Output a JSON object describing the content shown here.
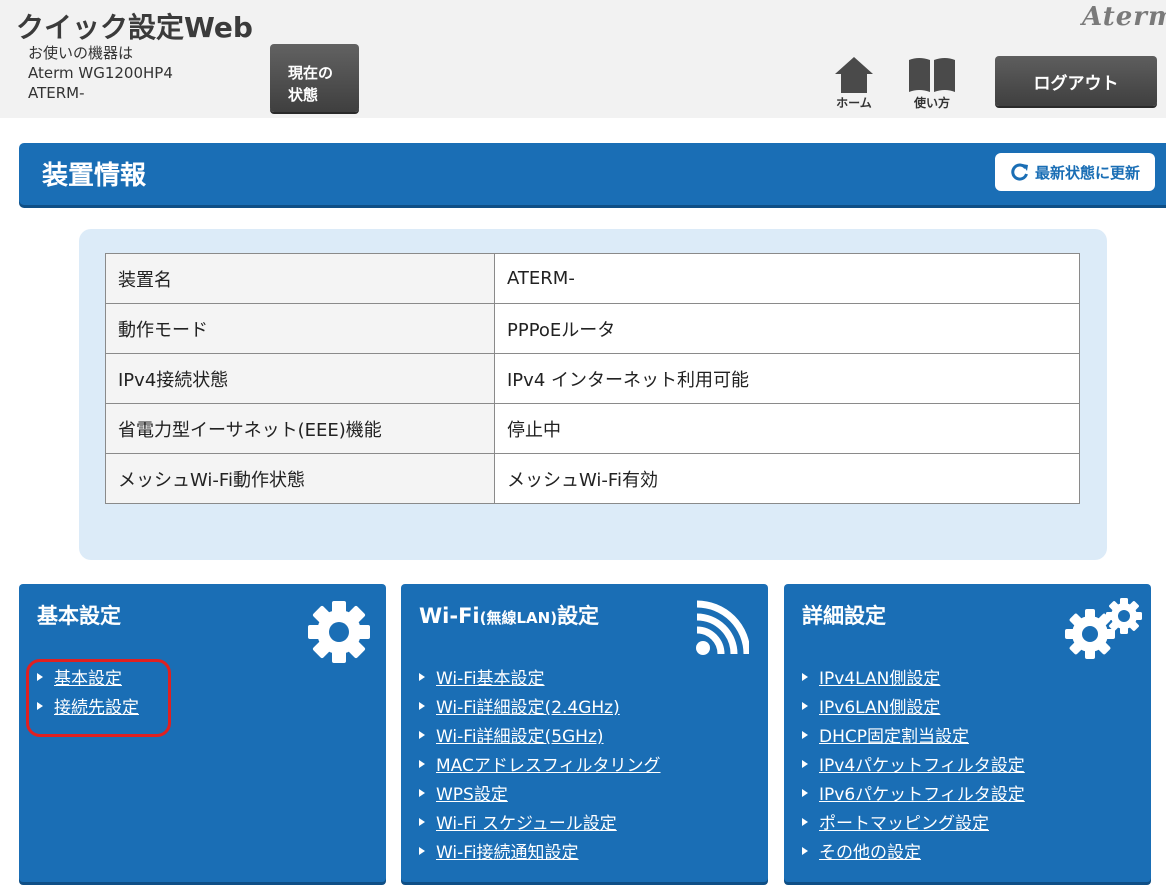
{
  "header": {
    "app_title": "クイック設定Web",
    "device_line1": "お使いの機器は",
    "device_line2": "Aterm WG1200HP4",
    "device_line3": "ATERM-",
    "status_button_line1": "現在の",
    "status_button_line2": "状態",
    "home_label": "ホーム",
    "manual_label": "使い方",
    "logout_label": "ログアウト",
    "brand": "Aterm"
  },
  "section": {
    "title": "装置情報",
    "refresh_label": "最新状態に更新"
  },
  "info_table": {
    "rows": [
      {
        "label": "装置名",
        "value": "ATERM-"
      },
      {
        "label": "動作モード",
        "value": "PPPoEルータ"
      },
      {
        "label": "IPv4接続状態",
        "value": "IPv4 インターネット利用可能"
      },
      {
        "label": "省電力型イーサネット(EEE)機能",
        "value": "停止中"
      },
      {
        "label": "メッシュWi-Fi動作状態",
        "value": "メッシュWi-Fi有効"
      }
    ]
  },
  "cards": {
    "basic": {
      "title": "基本設定",
      "icon": "gear-icon",
      "links": [
        "基本設定",
        "接続先設定"
      ]
    },
    "wifi": {
      "title_main": "Wi-Fi",
      "title_small": "(無線LAN)",
      "title_end": "設定",
      "icon": "wifi-icon",
      "links": [
        "Wi-Fi基本設定",
        "Wi-Fi詳細設定(2.4GHz)",
        "Wi-Fi詳細設定(5GHz)",
        "MACアドレスフィルタリング",
        "WPS設定",
        "Wi-Fi スケジュール設定",
        "Wi-Fi接続通知設定"
      ]
    },
    "detail": {
      "title": "詳細設定",
      "icon": "gears-icon",
      "links": [
        "IPv4LAN側設定",
        "IPv6LAN側設定",
        "DHCP固定割当設定",
        "IPv4パケットフィルタ設定",
        "IPv6パケットフィルタ設定",
        "ポートマッピング設定",
        "その他の設定"
      ]
    }
  },
  "colors": {
    "accent_blue": "#1a6eb5",
    "panel_blue": "#dcebf8",
    "highlight_red": "#e02020",
    "button_dark": "#4a4a4a"
  }
}
